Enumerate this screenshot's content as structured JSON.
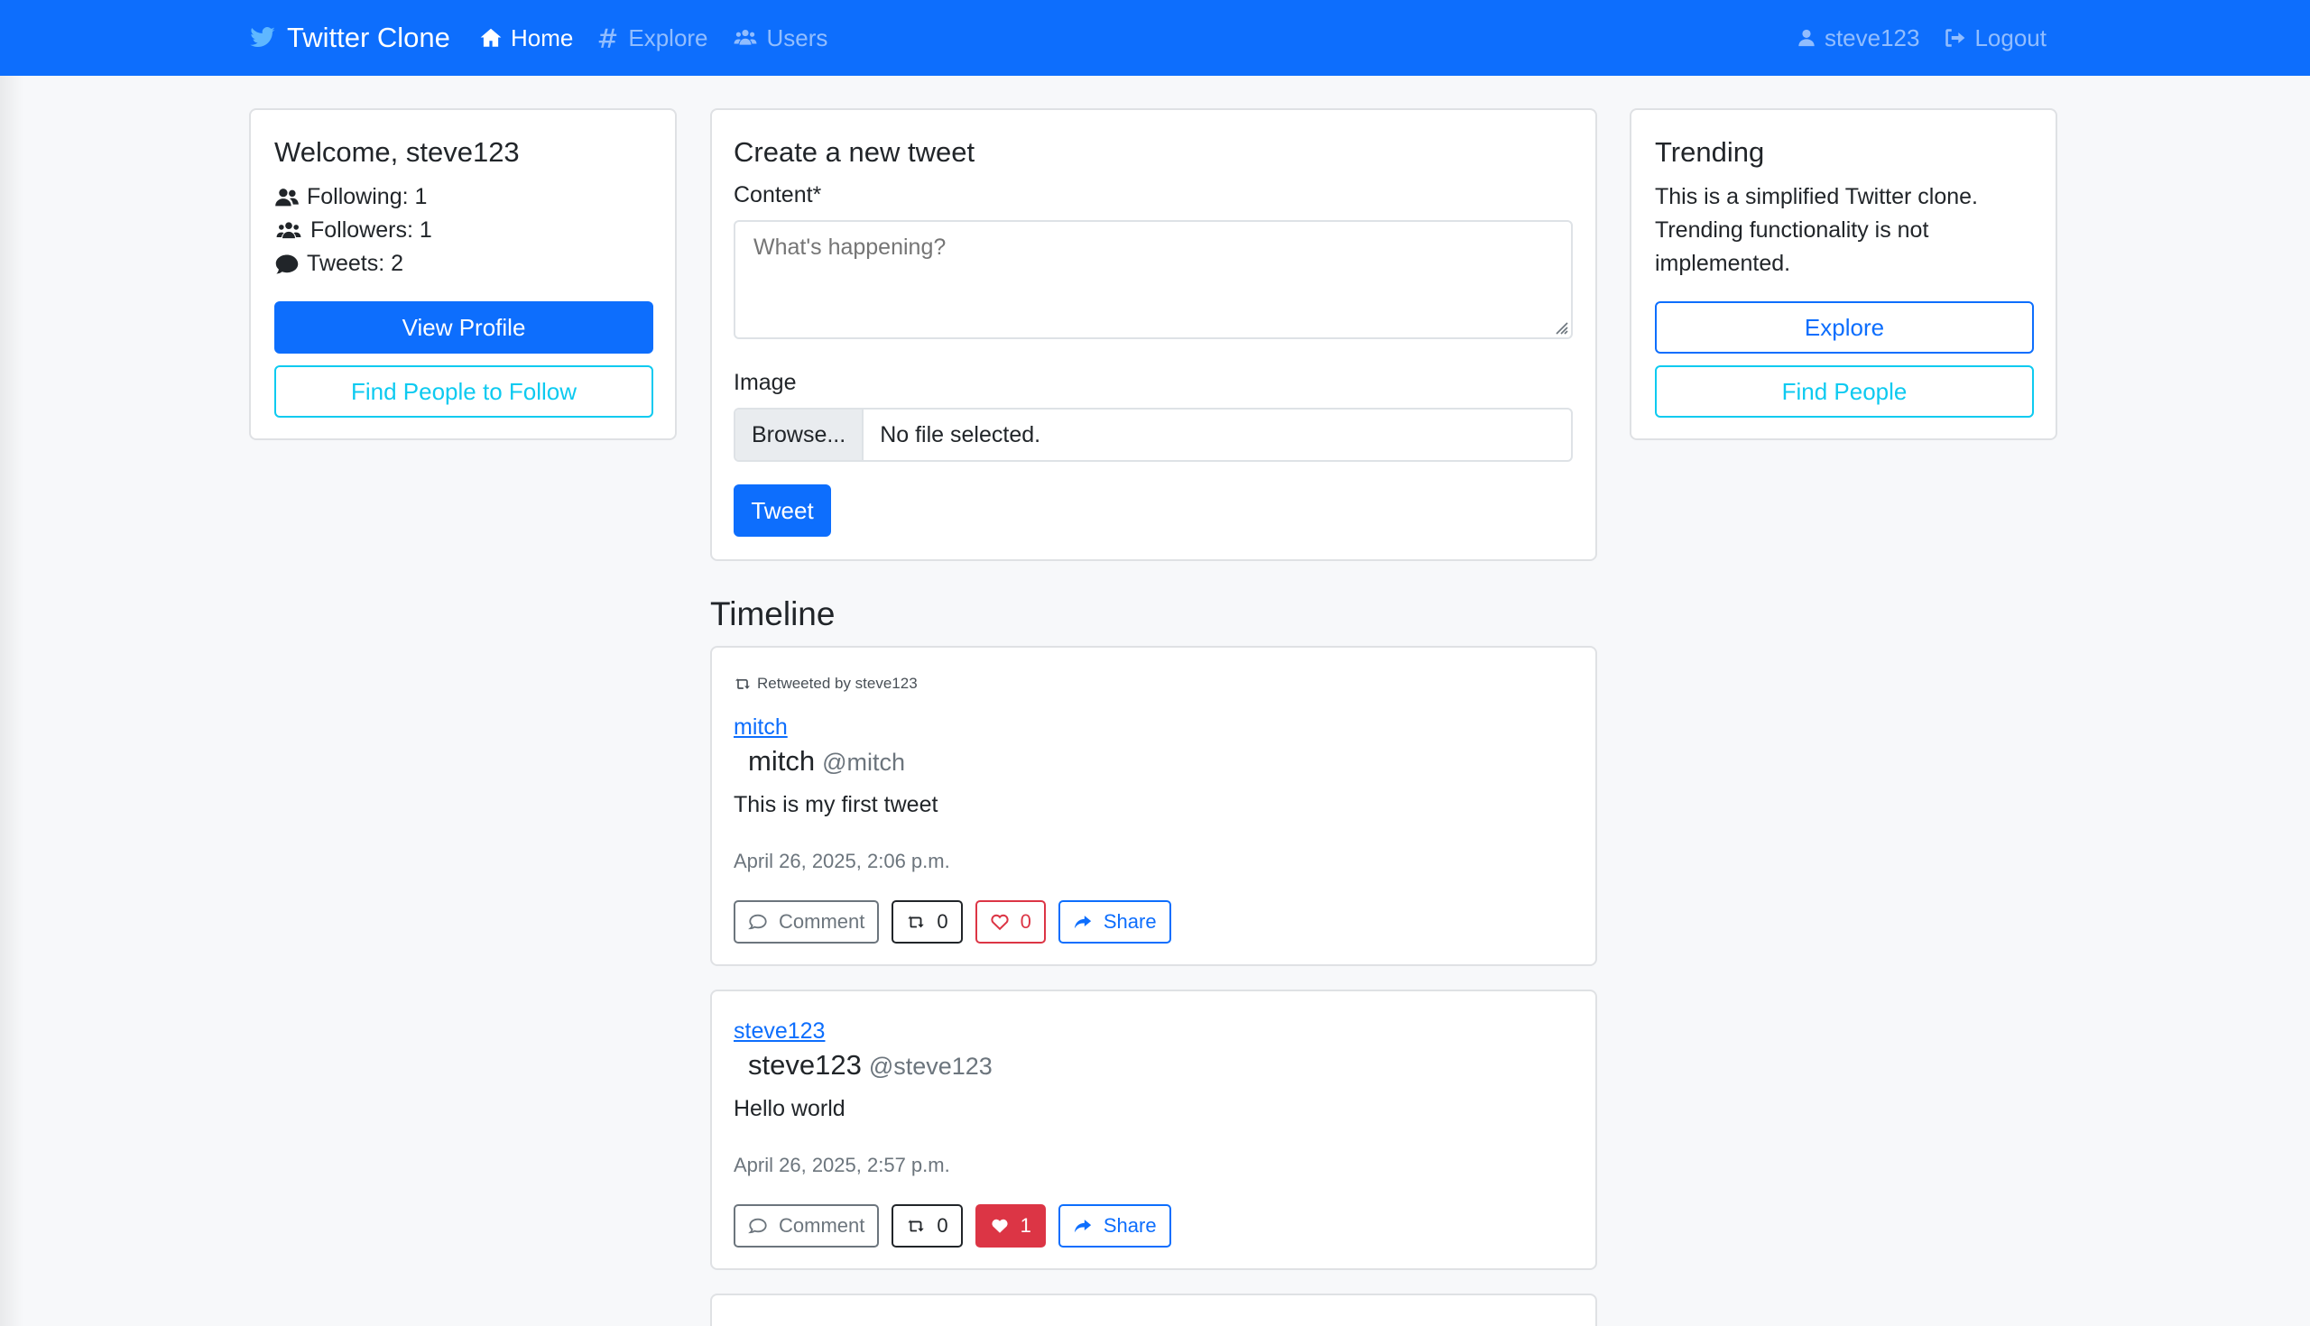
{
  "navbar": {
    "brand": "Twitter Clone",
    "links": [
      {
        "label": "Home",
        "icon": "home-icon",
        "active": true
      },
      {
        "label": "Explore",
        "icon": "hashtag-icon",
        "active": false
      },
      {
        "label": "Users",
        "icon": "users-icon",
        "active": false
      }
    ],
    "username": "steve123",
    "logout": "Logout"
  },
  "welcome": {
    "title": "Welcome, steve123",
    "following": "Following: 1",
    "followers": "Followers: 1",
    "tweets": "Tweets: 2",
    "view_profile": "View Profile",
    "find_people": "Find People to Follow"
  },
  "compose": {
    "title": "Create a new tweet",
    "content_label": "Content*",
    "placeholder": "What's happening?",
    "image_label": "Image",
    "browse": "Browse...",
    "file_status": "No file selected.",
    "submit": "Tweet"
  },
  "trending": {
    "title": "Trending",
    "text": "This is a simplified Twitter clone. Trending functionality is not implemented.",
    "explore": "Explore",
    "find_people": "Find People"
  },
  "timeline": {
    "title": "Timeline",
    "tweets": [
      {
        "retweet_note": "Retweeted by steve123",
        "author_link": "mitch",
        "name": "mitch",
        "handle": "@mitch",
        "content": "This is my first tweet",
        "date": "April 26, 2025, 2:06 p.m.",
        "comment": "Comment",
        "retweets": "0",
        "likes": "0",
        "liked": false,
        "share": "Share"
      },
      {
        "retweet_note": "",
        "author_link": "steve123",
        "name": "steve123",
        "handle": "@steve123",
        "content": "Hello world",
        "date": "April 26, 2025, 2:57 p.m.",
        "comment": "Comment",
        "retweets": "0",
        "likes": "1",
        "liked": true,
        "share": "Share"
      }
    ]
  },
  "colors": {
    "navbar": "#0d6efd",
    "primary": "#0d6efd",
    "info": "#0dcaf0",
    "danger": "#dc3545"
  }
}
